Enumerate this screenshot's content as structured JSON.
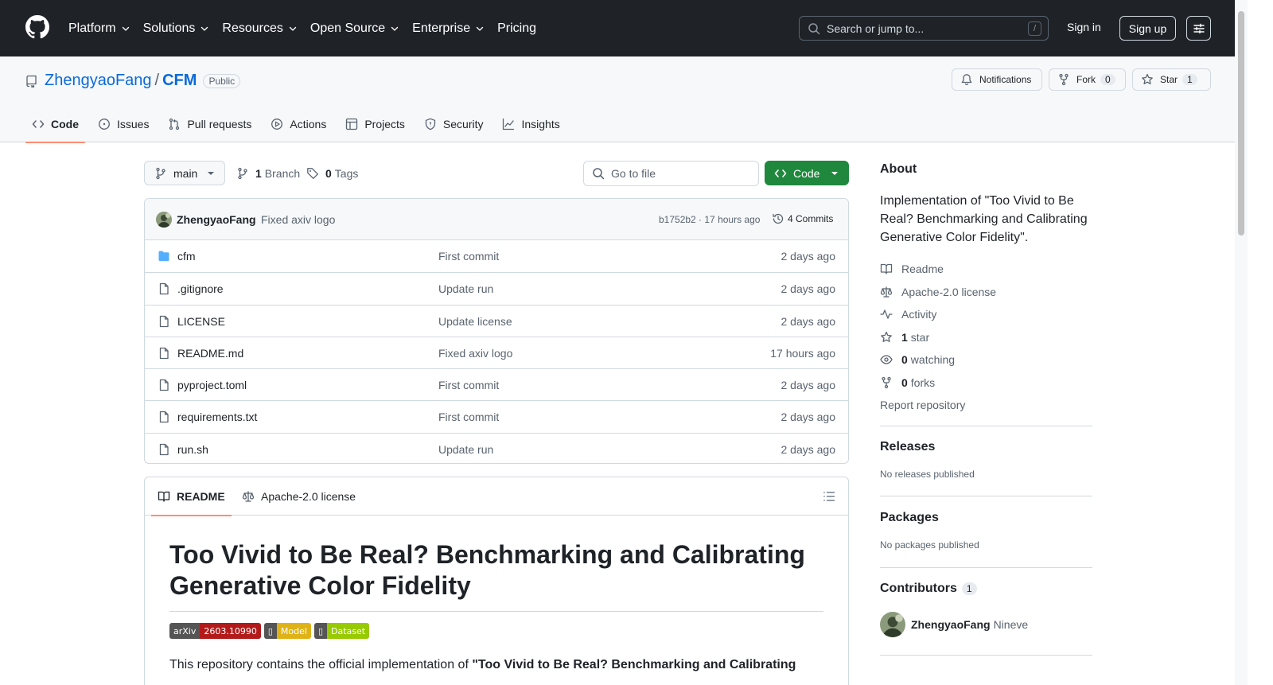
{
  "topnav": {
    "items": [
      {
        "label": "Platform",
        "has_menu": true
      },
      {
        "label": "Solutions",
        "has_menu": true
      },
      {
        "label": "Resources",
        "has_menu": true
      },
      {
        "label": "Open Source",
        "has_menu": true
      },
      {
        "label": "Enterprise",
        "has_menu": true
      },
      {
        "label": "Pricing",
        "has_menu": false
      }
    ],
    "search_placeholder": "Search or jump to...",
    "search_key": "/",
    "sign_in": "Sign in",
    "sign_up": "Sign up"
  },
  "repo": {
    "owner": "ZhengyaoFang",
    "separator": "/",
    "name": "CFM",
    "visibility": "Public",
    "notifications_label": "Notifications",
    "fork_label": "Fork",
    "fork_count": "0",
    "star_label": "Star",
    "star_count": "1"
  },
  "tabs": [
    {
      "label": "Code",
      "icon": "code-icon",
      "active": true
    },
    {
      "label": "Issues",
      "icon": "issue-icon"
    },
    {
      "label": "Pull requests",
      "icon": "pull-request-icon"
    },
    {
      "label": "Actions",
      "icon": "play-icon"
    },
    {
      "label": "Projects",
      "icon": "table-icon"
    },
    {
      "label": "Security",
      "icon": "shield-icon"
    },
    {
      "label": "Insights",
      "icon": "graph-icon"
    }
  ],
  "toolbar": {
    "branch": "main",
    "branch_count": "1",
    "branch_label": "Branch",
    "tag_count": "0",
    "tag_label": "Tags",
    "goto_placeholder": "Go to file",
    "code_label": "Code"
  },
  "latest_commit": {
    "author": "ZhengyaoFang",
    "message": "Fixed axiv logo",
    "sha_time": "b1752b2 · 17 hours ago",
    "commits": "4 Commits"
  },
  "files": [
    {
      "name": "cfm",
      "type": "dir",
      "message": "First commit",
      "date": "2 days ago"
    },
    {
      "name": ".gitignore",
      "type": "file",
      "message": "Update run",
      "date": "2 days ago"
    },
    {
      "name": "LICENSE",
      "type": "file",
      "message": "Update license",
      "date": "2 days ago"
    },
    {
      "name": "README.md",
      "type": "file",
      "message": "Fixed axiv logo",
      "date": "17 hours ago"
    },
    {
      "name": "pyproject.toml",
      "type": "file",
      "message": "First commit",
      "date": "2 days ago"
    },
    {
      "name": "requirements.txt",
      "type": "file",
      "message": "First commit",
      "date": "2 days ago"
    },
    {
      "name": "run.sh",
      "type": "file",
      "message": "Update run",
      "date": "2 days ago"
    }
  ],
  "readme": {
    "tab_readme": "README",
    "tab_license": "Apache-2.0 license",
    "title": "Too Vivid to Be Real? Benchmarking and Calibrating Generative Color Fidelity",
    "badges": [
      {
        "left": "arXiv",
        "right": "2603.10990",
        "left_color": "#555555",
        "right_color": "#b31b1b"
      },
      {
        "left": "▯",
        "right": "Model",
        "left_color": "#555555",
        "right_color": "#dfb317"
      },
      {
        "left": "▯",
        "right": "Dataset",
        "left_color": "#555555",
        "right_color": "#97ca00"
      }
    ],
    "intro_prefix": "This repository contains the official implementation of ",
    "intro_bold": "\"Too Vivid to Be Real? Benchmarking and Calibrating"
  },
  "about": {
    "heading": "About",
    "description": "Implementation of \"Too Vivid to Be Real? Benchmarking and Calibrating Generative Color Fidelity\".",
    "readme": "Readme",
    "license": "Apache-2.0 license",
    "activity": "Activity",
    "stars_count": "1",
    "stars_label": "star",
    "watching_count": "0",
    "watching_label": "watching",
    "forks_count": "0",
    "forks_label": "forks",
    "report": "Report repository"
  },
  "releases": {
    "heading": "Releases",
    "empty": "No releases published"
  },
  "packages": {
    "heading": "Packages",
    "empty": "No packages published"
  },
  "contributors": {
    "heading": "Contributors",
    "count": "1",
    "items": [
      {
        "login": "ZhengyaoFang",
        "name": "Nineve"
      }
    ]
  },
  "colors": {
    "header_bg": "#1f2328",
    "link": "#0969da",
    "primary_button": "#1f883d",
    "tab_underline": "#fd8c73",
    "folder": "#54aeff"
  }
}
